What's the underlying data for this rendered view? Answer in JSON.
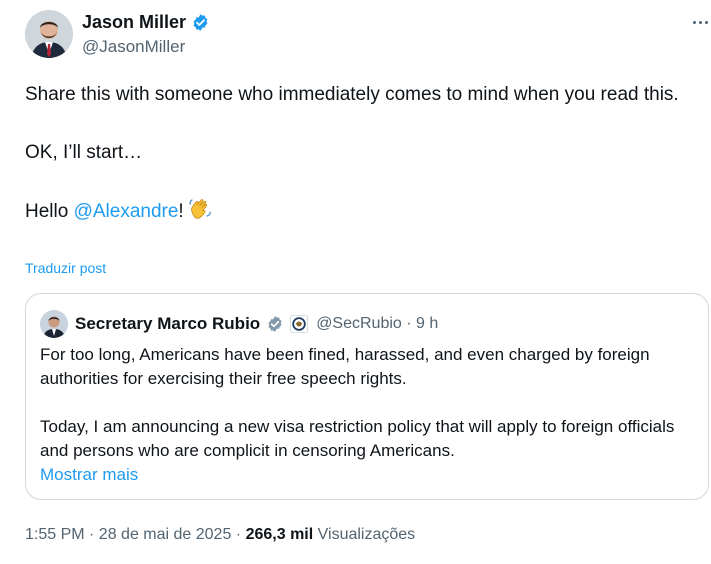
{
  "author": {
    "name": "Jason Miller",
    "handle": "@JasonMiller",
    "verified_color": "#1d9bf0"
  },
  "post": {
    "line1": "Share this with someone who immediately comes to mind when you read this.",
    "line2": "OK, I’ll start…",
    "hello": "Hello ",
    "mention": "@Alexandre",
    "after_mention": "!",
    "emoji_icon": "waving-hand-icon",
    "translate_label": "Traduzir post"
  },
  "quote": {
    "name": "Secretary Marco Rubio",
    "handle_time": "@SecRubio · 9 h",
    "paragraph1": "For too long, Americans have been fined, harassed, and even charged by foreign authorities for exercising their free speech rights.",
    "paragraph2": "Today, I am announcing a new visa restriction policy that will apply to foreign officials and persons who are complicit in censoring Americans.",
    "show_more": "Mostrar mais",
    "badge_color": "#829aab"
  },
  "meta": {
    "time_date": "1:55 PM · 28 de mai de 2025 · ",
    "views_count": "266,3 mil",
    "views_label": " Visualizações"
  },
  "colors": {
    "link": "#1d9bf0",
    "secondary_text": "#536471",
    "border": "#cfd9de"
  }
}
